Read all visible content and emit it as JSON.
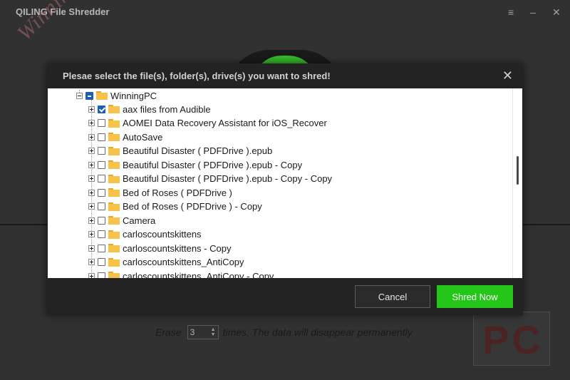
{
  "app": {
    "title": "QILING File Shredder"
  },
  "window_controls": {
    "menu": "≡",
    "minimize": "–",
    "close": "✕"
  },
  "watermark": {
    "text": "WinningPC",
    "logo_text": "PC"
  },
  "erase": {
    "prefix": "Erase",
    "value": "3",
    "suffix": "times, The data will disappear permanently"
  },
  "dialog": {
    "title": "Plesae select the file(s), folder(s), drive(s) you want to shred!",
    "close": "✕",
    "root": {
      "label": "WinningPC",
      "state": "partial"
    },
    "items": [
      {
        "label": "aax files from Audible",
        "checked": true
      },
      {
        "label": "AOMEI Data Recovery Assistant for iOS_Recover",
        "checked": false
      },
      {
        "label": "AutoSave",
        "checked": false
      },
      {
        "label": "Beautiful Disaster ( PDFDrive ).epub",
        "checked": false
      },
      {
        "label": "Beautiful Disaster ( PDFDrive ).epub - Copy",
        "checked": false
      },
      {
        "label": "Beautiful Disaster ( PDFDrive ).epub - Copy - Copy",
        "checked": false
      },
      {
        "label": "Bed of Roses ( PDFDrive )",
        "checked": false
      },
      {
        "label": "Bed of Roses ( PDFDrive ) - Copy",
        "checked": false
      },
      {
        "label": "Camera",
        "checked": false
      },
      {
        "label": "carloscountskittens",
        "checked": false
      },
      {
        "label": "carloscountskittens - Copy",
        "checked": false
      },
      {
        "label": "carloscountskittens_AntiCopy",
        "checked": false
      },
      {
        "label": "carloscountskittens_AntiCopy - Copy",
        "checked": false
      }
    ],
    "cancel_label": "Cancel",
    "shred_label": "Shred Now"
  },
  "colors": {
    "accent": "#23c619",
    "checkbox": "#1a5fb4",
    "folder": "#f7c24a"
  }
}
